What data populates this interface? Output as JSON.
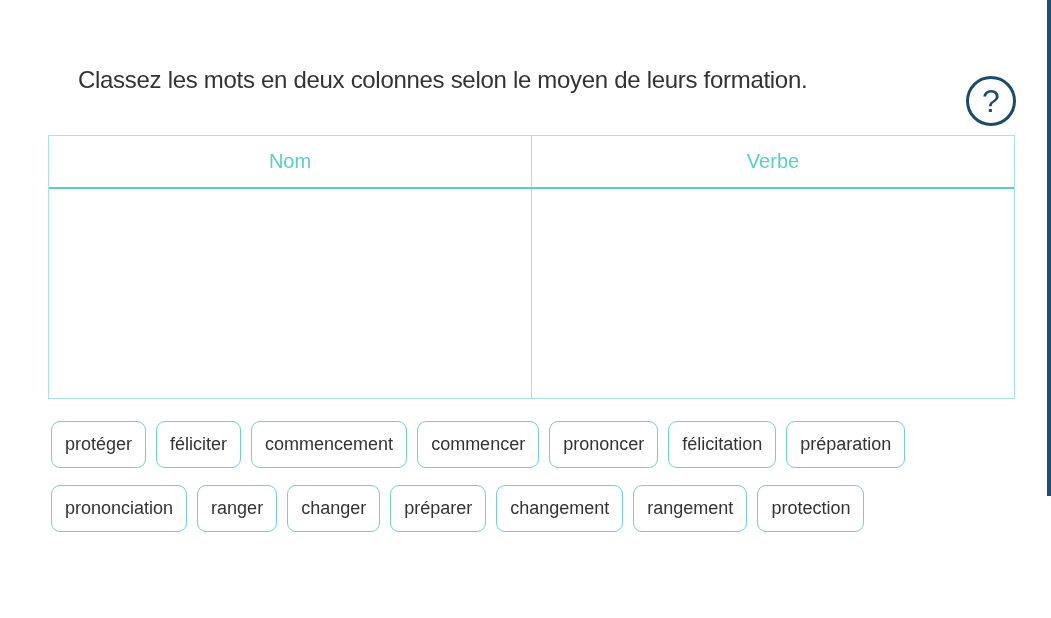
{
  "instruction": "Classez les mots en deux colonnes selon le moyen de leurs formation.",
  "help": {
    "label": "?"
  },
  "table": {
    "columns": [
      "Nom",
      "Verbe"
    ]
  },
  "word_bank": [
    [
      "protéger",
      "féliciter",
      "commencement",
      "commencer",
      "prononcer",
      "félicitation",
      "préparation"
    ],
    [
      "prononciation",
      "ranger",
      "changer",
      "préparer",
      "changement",
      "rangement",
      "protection"
    ]
  ]
}
